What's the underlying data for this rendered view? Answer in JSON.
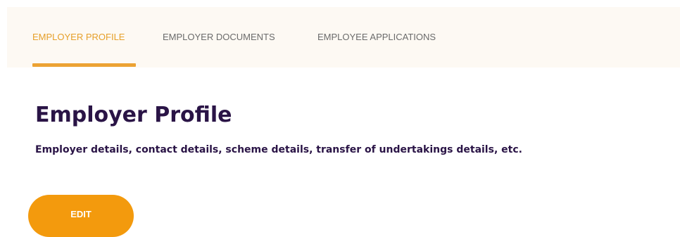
{
  "tabs": [
    {
      "label": "EMPLOYER PROFILE",
      "active": true
    },
    {
      "label": "EMPLOYER DOCUMENTS",
      "active": false
    },
    {
      "label": "EMPLOYEE APPLICATIONS",
      "active": false
    }
  ],
  "page": {
    "title": "Employer Profile",
    "subtitle": "Employer details, contact details, scheme details, transfer of undertakings details, etc."
  },
  "actions": {
    "edit_label": "EDIT"
  },
  "colors": {
    "accent": "#f39a0d",
    "active_tab": "#e6a02a",
    "heading": "#2a1446",
    "tabbar_bg": "#fdf9f3"
  }
}
